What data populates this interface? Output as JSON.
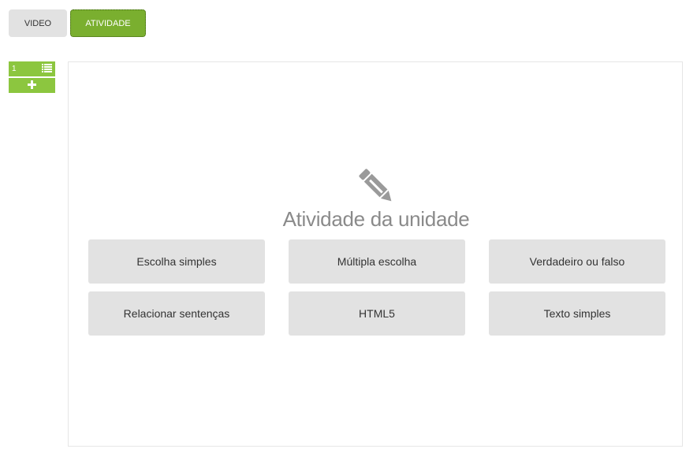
{
  "tabs": {
    "video_label": "VIDEO",
    "atividade_label": "ATIVIDADE"
  },
  "slides": {
    "items": [
      {
        "number": "1",
        "icon": "list-icon"
      }
    ],
    "add_icon": "plus-icon"
  },
  "activity": {
    "icon": "pencil-icon",
    "title": "Atividade da unidade",
    "options": [
      "Escolha simples",
      "Múltipla escolha",
      "Verdadeiro ou falso",
      "Relacionar sentenças",
      "HTML5",
      "Texto simples"
    ]
  },
  "colors": {
    "accent_green": "#8cc63f",
    "active_tab": "#7aaf2f",
    "button_grey": "#e2e2e2",
    "title_grey": "#8a8a8a"
  }
}
